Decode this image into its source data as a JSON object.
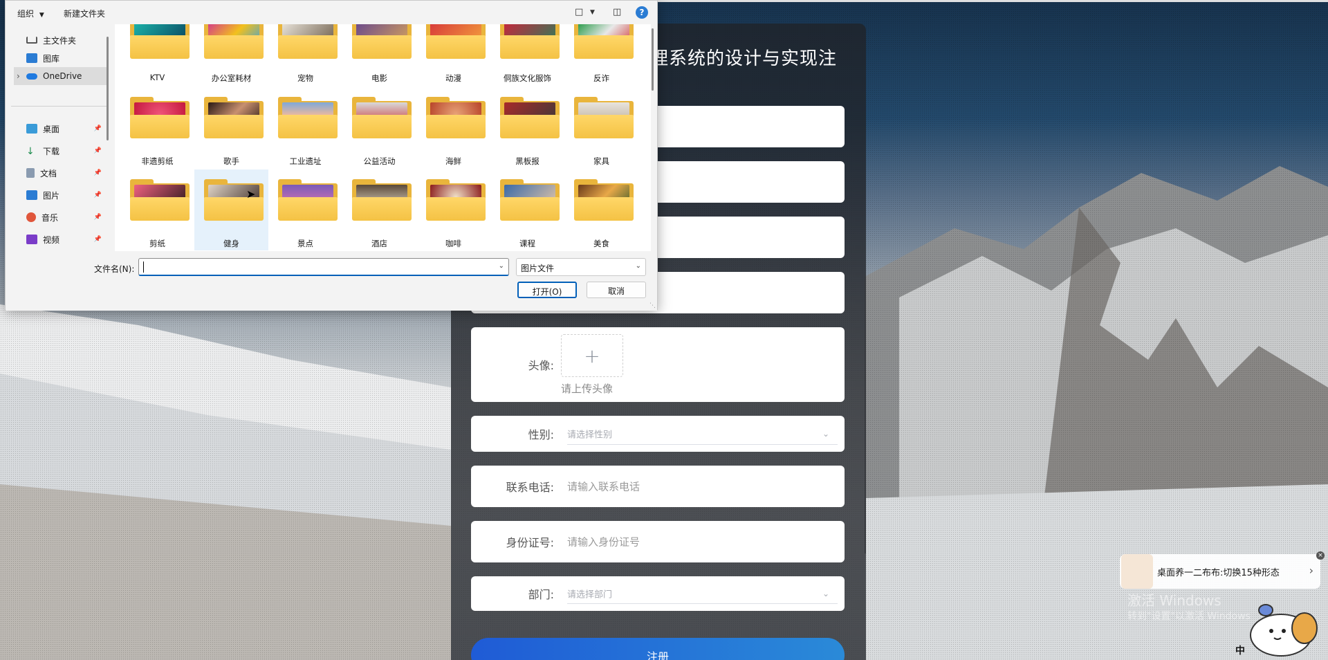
{
  "register_form": {
    "title": "理系统的设计与实现注",
    "avatar": {
      "label": "头像:",
      "hint": "请上传头像",
      "upload_symbol": "+"
    },
    "gender": {
      "label": "性别:",
      "placeholder": "请选择性别"
    },
    "phone": {
      "label": "联系电话:",
      "placeholder": "请输入联系电话"
    },
    "id_card": {
      "label": "身份证号:",
      "placeholder": "请输入身份证号"
    },
    "department": {
      "label": "部门:",
      "placeholder": "请选择部门"
    },
    "submit_label": "注册"
  },
  "file_dialog": {
    "toolbar": {
      "organize_label": "组织",
      "new_folder_label": "新建文件夹",
      "view_icon": "view-icon",
      "preview_icon": "preview-pane-icon",
      "help_icon": "help-icon",
      "help_glyph": "?"
    },
    "nav": {
      "quick": [
        {
          "label": "主文件夹",
          "icon": "home-icon"
        },
        {
          "label": "图库",
          "icon": "gallery-icon"
        },
        {
          "label": "OneDrive",
          "icon": "cloud-icon",
          "expand_glyph": "›"
        }
      ],
      "pinned": [
        {
          "label": "桌面",
          "icon": "desktop-icon"
        },
        {
          "label": "下载",
          "icon": "download-icon"
        },
        {
          "label": "文档",
          "icon": "document-icon"
        },
        {
          "label": "图片",
          "icon": "pictures-icon"
        },
        {
          "label": "音乐",
          "icon": "music-icon"
        },
        {
          "label": "视频",
          "icon": "video-icon"
        }
      ],
      "pin_glyph": "📌"
    },
    "folders_row1": [
      "KTV",
      "办公室耗材",
      "宠物",
      "电影",
      "动漫",
      "侗族文化服饰",
      "反诈"
    ],
    "folders_row2": [
      "非遗剪纸",
      "歌手",
      "工业遗址",
      "公益活动",
      "海鲜",
      "黑板报",
      "家具"
    ],
    "folders_row3": [
      "剪纸",
      "健身",
      "景点",
      "酒店",
      "咖啡",
      "课程",
      "美食"
    ],
    "selected_folder": "健身",
    "filename_label": "文件名(N):",
    "filename_value": "",
    "filetype_value": "图片文件",
    "open_label": "打开(O)",
    "cancel_label": "取消"
  },
  "desktop_overlay": {
    "notification_text": "桌面养一二布布:切换15种形态",
    "notification_chevron": "›",
    "close_glyph": "×",
    "watermark_title": "激活 Windows",
    "watermark_sub": "转到\"设置\"以激活 Windows",
    "ime_indicator": "中"
  },
  "colors": {
    "accent": "#005fb8",
    "register_button_start": "#1f5bd6",
    "register_button_end": "#2a8ad8",
    "folder_yellow": "#f4c244"
  }
}
